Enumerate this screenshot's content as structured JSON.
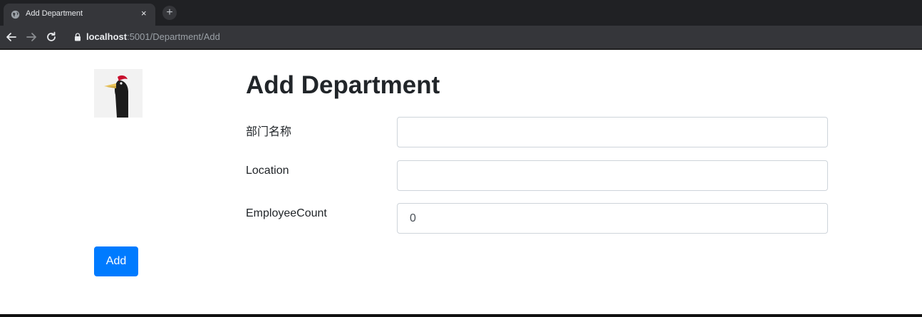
{
  "browser": {
    "tab_title": "Add Department",
    "tab_close": "×",
    "new_tab": "+",
    "url_host": "localhost",
    "url_rest": ":5001/Department/Add"
  },
  "page": {
    "title": "Add Department",
    "logo_icon": "woodpecker-bird-logo"
  },
  "form": {
    "department_name_label": "部门名称",
    "department_name_value": "",
    "location_label": "Location",
    "location_value": "",
    "employee_count_label": "EmployeeCount",
    "employee_count_value": "0",
    "submit_label": "Add"
  },
  "colors": {
    "primary": "#007bff",
    "text": "#212529",
    "chrome_dark": "#202124",
    "chrome_toolbar": "#35363a"
  }
}
